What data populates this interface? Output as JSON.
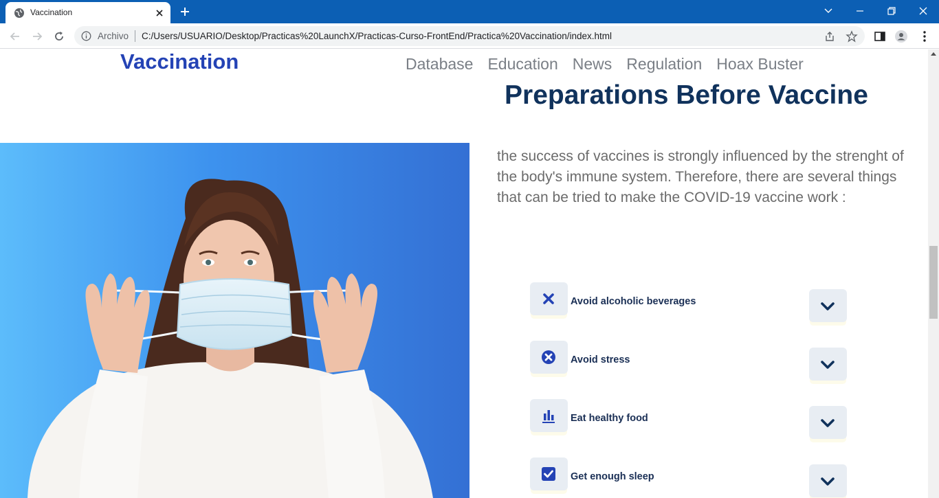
{
  "browser": {
    "tab_title": "Vaccination",
    "scheme_label": "Archivo",
    "url": "C:/Users/USUARIO/Desktop/Practicas%20LaunchX/Practicas-Curso-FrontEnd/Practica%20Vaccination/index.html"
  },
  "header": {
    "logo": "Vaccination",
    "nav": [
      "Database",
      "Education",
      "News",
      "Regulation",
      "Hoax Buster"
    ]
  },
  "section": {
    "title": "Preparations Before Vaccine",
    "intro": "the success of vaccines is strongly influenced by the strenght of the body's immune system. Therefore, there are several things that can be tried to make the COVID-19 vaccine work :",
    "items": [
      {
        "label": "Avoid alcoholic beverages",
        "icon": "x-mark-icon"
      },
      {
        "label": "Avoid stress",
        "icon": "x-circle-icon"
      },
      {
        "label": "Eat healthy food",
        "icon": "bar-chart-icon"
      },
      {
        "label": "Get enough sleep",
        "icon": "check-square-icon"
      }
    ]
  },
  "colors": {
    "titlebar": "#0c5fb4",
    "logo": "#2443b5",
    "heading": "#10325c",
    "nav": "#7a7f86",
    "icon_accent": "#2443b5"
  }
}
